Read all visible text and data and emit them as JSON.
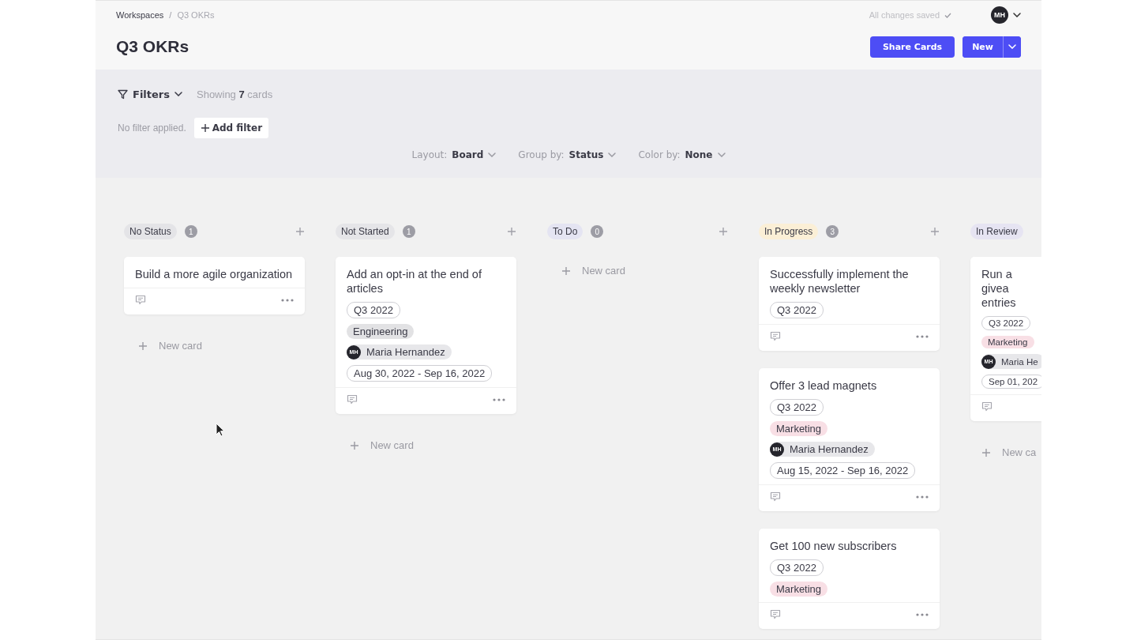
{
  "breadcrumb": [
    "Workspaces",
    "/",
    "Q3 OKRs"
  ],
  "save_status": "All changes saved",
  "user": {
    "initials": "MH"
  },
  "title": "Q3 OKRs",
  "actions": {
    "share": "Share Cards",
    "new": "New"
  },
  "filters": {
    "label": "Filters",
    "showing_prefix": "Showing",
    "showing_count": "7",
    "showing_suffix": "cards",
    "empty_note": "No filter applied.",
    "add": "Add filter"
  },
  "view_options": [
    {
      "label": "Layout:",
      "value": "Board"
    },
    {
      "label": "Group by:",
      "value": "Status"
    },
    {
      "label": "Color by:",
      "value": "None"
    }
  ],
  "columns": [
    {
      "name": "No Status",
      "count": "1",
      "color": "#e4e4e7",
      "new_card": "New card",
      "cards": [
        {
          "title": "Build a more agile organization"
        }
      ]
    },
    {
      "name": "Not Started",
      "count": "1",
      "color": "#e5e5e8",
      "new_card": "New card",
      "cards": [
        {
          "title": "Add an opt-in at the end of articles",
          "tags": [
            {
              "kind": "outline",
              "text": "Q3 2022"
            },
            {
              "kind": "tag",
              "text": "Engineering",
              "color": "#e2e2e4"
            },
            {
              "kind": "person",
              "initials": "MH",
              "text": "Maria Hernandez"
            },
            {
              "kind": "outline",
              "text": "Aug 30, 2022 - Sep 16, 2022"
            }
          ]
        }
      ]
    },
    {
      "name": "To Do",
      "count": "0",
      "color": "#e4e4f2",
      "new_card": "New card"
    },
    {
      "name": "In Progress",
      "count": "3",
      "color": "#fbefd6",
      "cards": [
        {
          "title": "Successfully implement the weekly newsletter",
          "tags": [
            {
              "kind": "outline",
              "text": "Q3 2022"
            }
          ]
        },
        {
          "title": "Offer 3 lead magnets",
          "tags": [
            {
              "kind": "outline",
              "text": "Q3 2022"
            },
            {
              "kind": "tag",
              "text": "Marketing",
              "color": "#f8dfe5"
            },
            {
              "kind": "person",
              "initials": "MH",
              "text": "Maria Hernandez"
            },
            {
              "kind": "outline",
              "text": "Aug 15, 2022 - Sep 16, 2022"
            }
          ]
        },
        {
          "title": "Get 100 new subscribers",
          "tags": [
            {
              "kind": "outline",
              "text": "Q3 2022"
            },
            {
              "kind": "tag",
              "text": "Marketing",
              "color": "#f8dfe5"
            }
          ]
        }
      ]
    },
    {
      "name": "In Review",
      "color": "#e6e4f2",
      "new_card": "New ca",
      "cards": [
        {
          "title": "Run a givea\nentries",
          "tags": [
            {
              "kind": "outline",
              "text": "Q3 2022"
            },
            {
              "kind": "tag",
              "text": "Marketing",
              "color": "#f8dfe5"
            },
            {
              "kind": "person",
              "initials": "MH",
              "text": "Maria He"
            },
            {
              "kind": "outline",
              "text": "Sep 01, 202"
            }
          ]
        }
      ]
    }
  ]
}
